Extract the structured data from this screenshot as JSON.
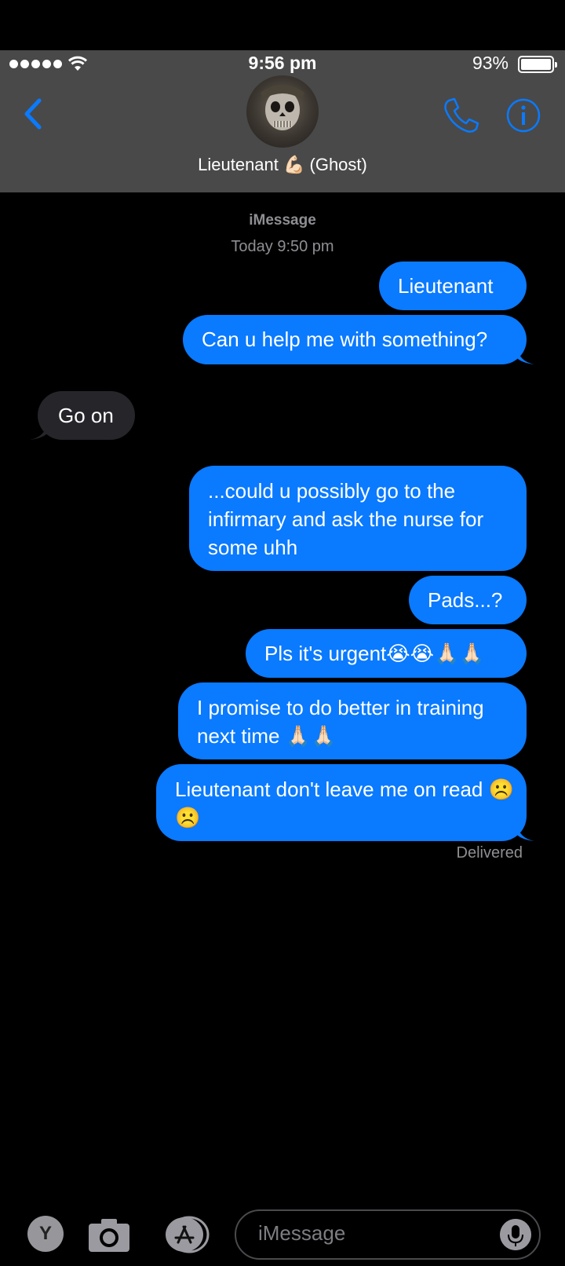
{
  "status_bar": {
    "time": "9:56 pm",
    "battery_percent": "93%",
    "battery_level": 0.93,
    "signal_bars": 5
  },
  "header": {
    "contact_name": "Lieutenant 💪🏻 (Ghost)",
    "accent_color": "#0a7aff",
    "back_icon": "chevron-left-icon",
    "phone_icon": "phone-icon",
    "info_icon": "info-icon"
  },
  "thread": {
    "service": "iMessage",
    "timestamp": "Today 9:50 pm",
    "delivered": "Delivered"
  },
  "messages": [
    {
      "side": "sent",
      "text": "Lieutenant"
    },
    {
      "side": "sent",
      "text": "Can u help me with something?"
    },
    {
      "side": "received",
      "text": "Go on"
    },
    {
      "side": "sent",
      "text": "...could u possibly go to the infirmary and ask the nurse for some uhh"
    },
    {
      "side": "sent",
      "text": "Pads...?"
    },
    {
      "side": "sent",
      "text": "Pls it's urgent😭😭🙏🏻🙏🏻"
    },
    {
      "side": "sent",
      "text": "I promise to do better in training next time 🙏🏻🙏🏻"
    },
    {
      "side": "sent",
      "text": "Lieutenant don't leave me on read ☹️☹️"
    }
  ],
  "composer": {
    "placeholder": "iMessage",
    "app_icons": [
      "youtube-app-icon",
      "camera-icon",
      "app-store-icon",
      "microphone-icon"
    ]
  },
  "colors": {
    "sent_bubble": "#0a7aff",
    "received_bubble": "#26252a",
    "header_bg": "#494949"
  }
}
